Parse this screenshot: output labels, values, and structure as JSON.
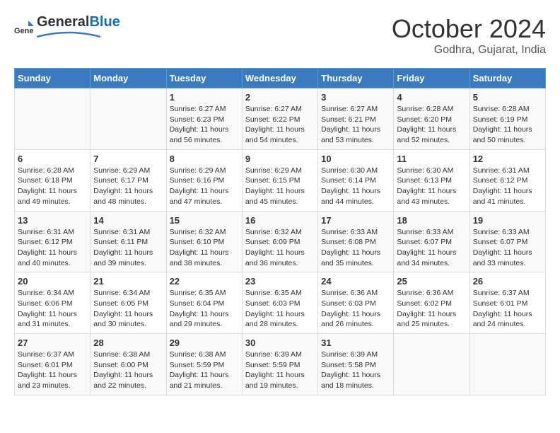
{
  "header": {
    "logo_general": "General",
    "logo_blue": "Blue",
    "month_title": "October 2024",
    "subtitle": "Godhra, Gujarat, India"
  },
  "days_of_week": [
    "Sunday",
    "Monday",
    "Tuesday",
    "Wednesday",
    "Thursday",
    "Friday",
    "Saturday"
  ],
  "weeks": [
    [
      {
        "day": "",
        "info": ""
      },
      {
        "day": "",
        "info": ""
      },
      {
        "day": "1",
        "info": "Sunrise: 6:27 AM\nSunset: 6:23 PM\nDaylight: 11 hours and 56 minutes."
      },
      {
        "day": "2",
        "info": "Sunrise: 6:27 AM\nSunset: 6:22 PM\nDaylight: 11 hours and 54 minutes."
      },
      {
        "day": "3",
        "info": "Sunrise: 6:27 AM\nSunset: 6:21 PM\nDaylight: 11 hours and 53 minutes."
      },
      {
        "day": "4",
        "info": "Sunrise: 6:28 AM\nSunset: 6:20 PM\nDaylight: 11 hours and 52 minutes."
      },
      {
        "day": "5",
        "info": "Sunrise: 6:28 AM\nSunset: 6:19 PM\nDaylight: 11 hours and 50 minutes."
      }
    ],
    [
      {
        "day": "6",
        "info": "Sunrise: 6:28 AM\nSunset: 6:18 PM\nDaylight: 11 hours and 49 minutes."
      },
      {
        "day": "7",
        "info": "Sunrise: 6:29 AM\nSunset: 6:17 PM\nDaylight: 11 hours and 48 minutes."
      },
      {
        "day": "8",
        "info": "Sunrise: 6:29 AM\nSunset: 6:16 PM\nDaylight: 11 hours and 47 minutes."
      },
      {
        "day": "9",
        "info": "Sunrise: 6:29 AM\nSunset: 6:15 PM\nDaylight: 11 hours and 45 minutes."
      },
      {
        "day": "10",
        "info": "Sunrise: 6:30 AM\nSunset: 6:14 PM\nDaylight: 11 hours and 44 minutes."
      },
      {
        "day": "11",
        "info": "Sunrise: 6:30 AM\nSunset: 6:13 PM\nDaylight: 11 hours and 43 minutes."
      },
      {
        "day": "12",
        "info": "Sunrise: 6:31 AM\nSunset: 6:12 PM\nDaylight: 11 hours and 41 minutes."
      }
    ],
    [
      {
        "day": "13",
        "info": "Sunrise: 6:31 AM\nSunset: 6:12 PM\nDaylight: 11 hours and 40 minutes."
      },
      {
        "day": "14",
        "info": "Sunrise: 6:31 AM\nSunset: 6:11 PM\nDaylight: 11 hours and 39 minutes."
      },
      {
        "day": "15",
        "info": "Sunrise: 6:32 AM\nSunset: 6:10 PM\nDaylight: 11 hours and 38 minutes."
      },
      {
        "day": "16",
        "info": "Sunrise: 6:32 AM\nSunset: 6:09 PM\nDaylight: 11 hours and 36 minutes."
      },
      {
        "day": "17",
        "info": "Sunrise: 6:33 AM\nSunset: 6:08 PM\nDaylight: 11 hours and 35 minutes."
      },
      {
        "day": "18",
        "info": "Sunrise: 6:33 AM\nSunset: 6:07 PM\nDaylight: 11 hours and 34 minutes."
      },
      {
        "day": "19",
        "info": "Sunrise: 6:33 AM\nSunset: 6:07 PM\nDaylight: 11 hours and 33 minutes."
      }
    ],
    [
      {
        "day": "20",
        "info": "Sunrise: 6:34 AM\nSunset: 6:06 PM\nDaylight: 11 hours and 31 minutes."
      },
      {
        "day": "21",
        "info": "Sunrise: 6:34 AM\nSunset: 6:05 PM\nDaylight: 11 hours and 30 minutes."
      },
      {
        "day": "22",
        "info": "Sunrise: 6:35 AM\nSunset: 6:04 PM\nDaylight: 11 hours and 29 minutes."
      },
      {
        "day": "23",
        "info": "Sunrise: 6:35 AM\nSunset: 6:03 PM\nDaylight: 11 hours and 28 minutes."
      },
      {
        "day": "24",
        "info": "Sunrise: 6:36 AM\nSunset: 6:03 PM\nDaylight: 11 hours and 26 minutes."
      },
      {
        "day": "25",
        "info": "Sunrise: 6:36 AM\nSunset: 6:02 PM\nDaylight: 11 hours and 25 minutes."
      },
      {
        "day": "26",
        "info": "Sunrise: 6:37 AM\nSunset: 6:01 PM\nDaylight: 11 hours and 24 minutes."
      }
    ],
    [
      {
        "day": "27",
        "info": "Sunrise: 6:37 AM\nSunset: 6:01 PM\nDaylight: 11 hours and 23 minutes."
      },
      {
        "day": "28",
        "info": "Sunrise: 6:38 AM\nSunset: 6:00 PM\nDaylight: 11 hours and 22 minutes."
      },
      {
        "day": "29",
        "info": "Sunrise: 6:38 AM\nSunset: 5:59 PM\nDaylight: 11 hours and 21 minutes."
      },
      {
        "day": "30",
        "info": "Sunrise: 6:39 AM\nSunset: 5:59 PM\nDaylight: 11 hours and 19 minutes."
      },
      {
        "day": "31",
        "info": "Sunrise: 6:39 AM\nSunset: 5:58 PM\nDaylight: 11 hours and 18 minutes."
      },
      {
        "day": "",
        "info": ""
      },
      {
        "day": "",
        "info": ""
      }
    ]
  ]
}
